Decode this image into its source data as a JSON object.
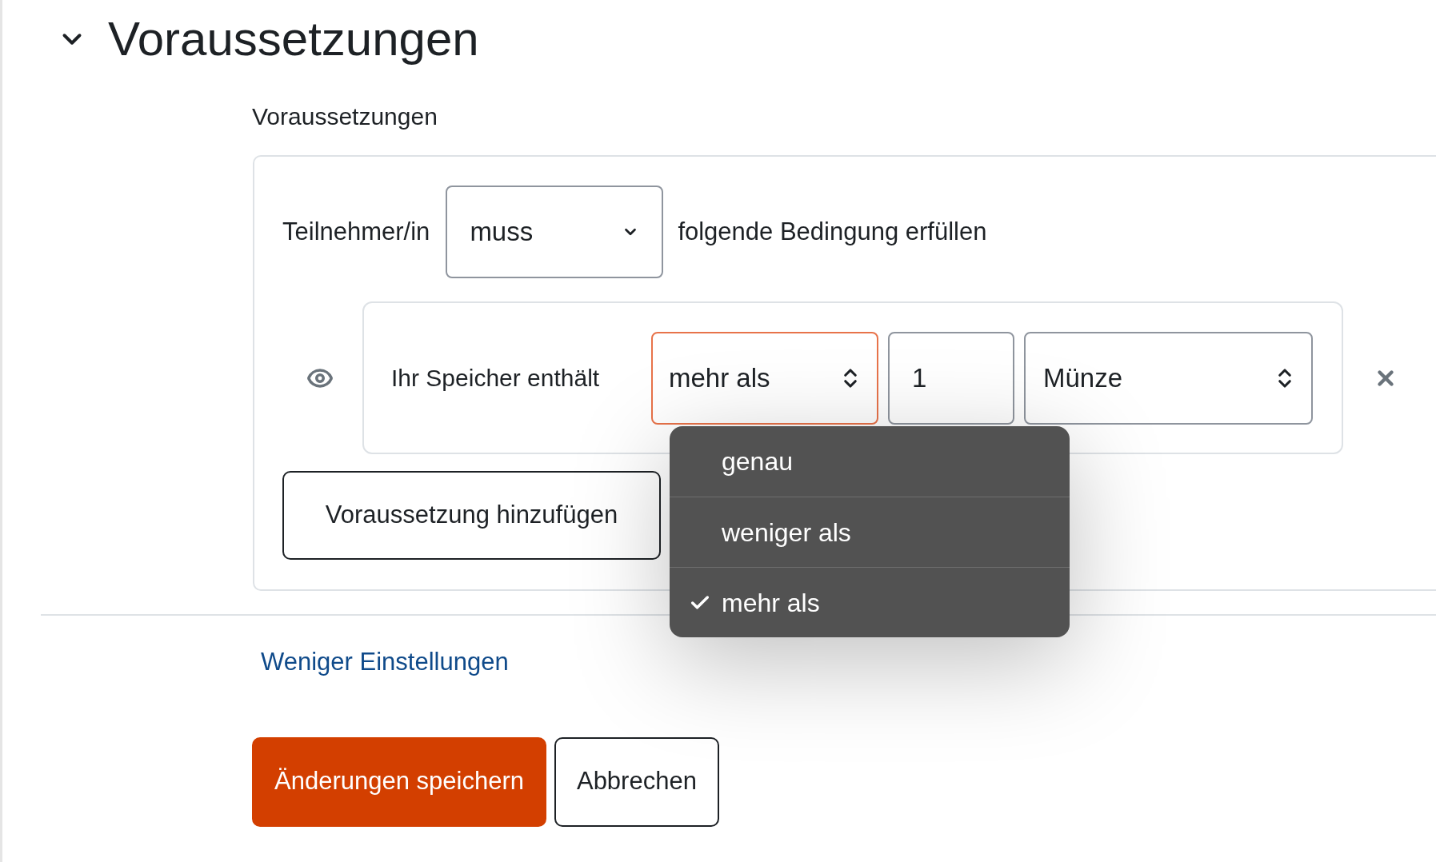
{
  "section": {
    "title": "Voraussetzungen",
    "expanded": true
  },
  "field_label": "Voraussetzungen",
  "restriction": {
    "prefix": "Teilnehmer/in",
    "mode": "muss",
    "suffix": "folgende Bedingung erfüllen",
    "condition": {
      "visible": true,
      "label": "Ihr Speicher enthält",
      "operator": {
        "value": "mehr als",
        "open": true,
        "options": [
          {
            "label": "genau",
            "selected": false
          },
          {
            "label": "weniger als",
            "selected": false
          },
          {
            "label": "mehr als",
            "selected": true
          }
        ]
      },
      "amount": "1",
      "unit": "Münze"
    },
    "add_button": "Voraussetzung hinzufügen"
  },
  "link": "Weniger Einstellungen",
  "buttons": [
    {
      "label": "Änderungen speichern",
      "kind": "primary"
    },
    {
      "label": "Abbrechen",
      "kind": "secondary"
    }
  ]
}
